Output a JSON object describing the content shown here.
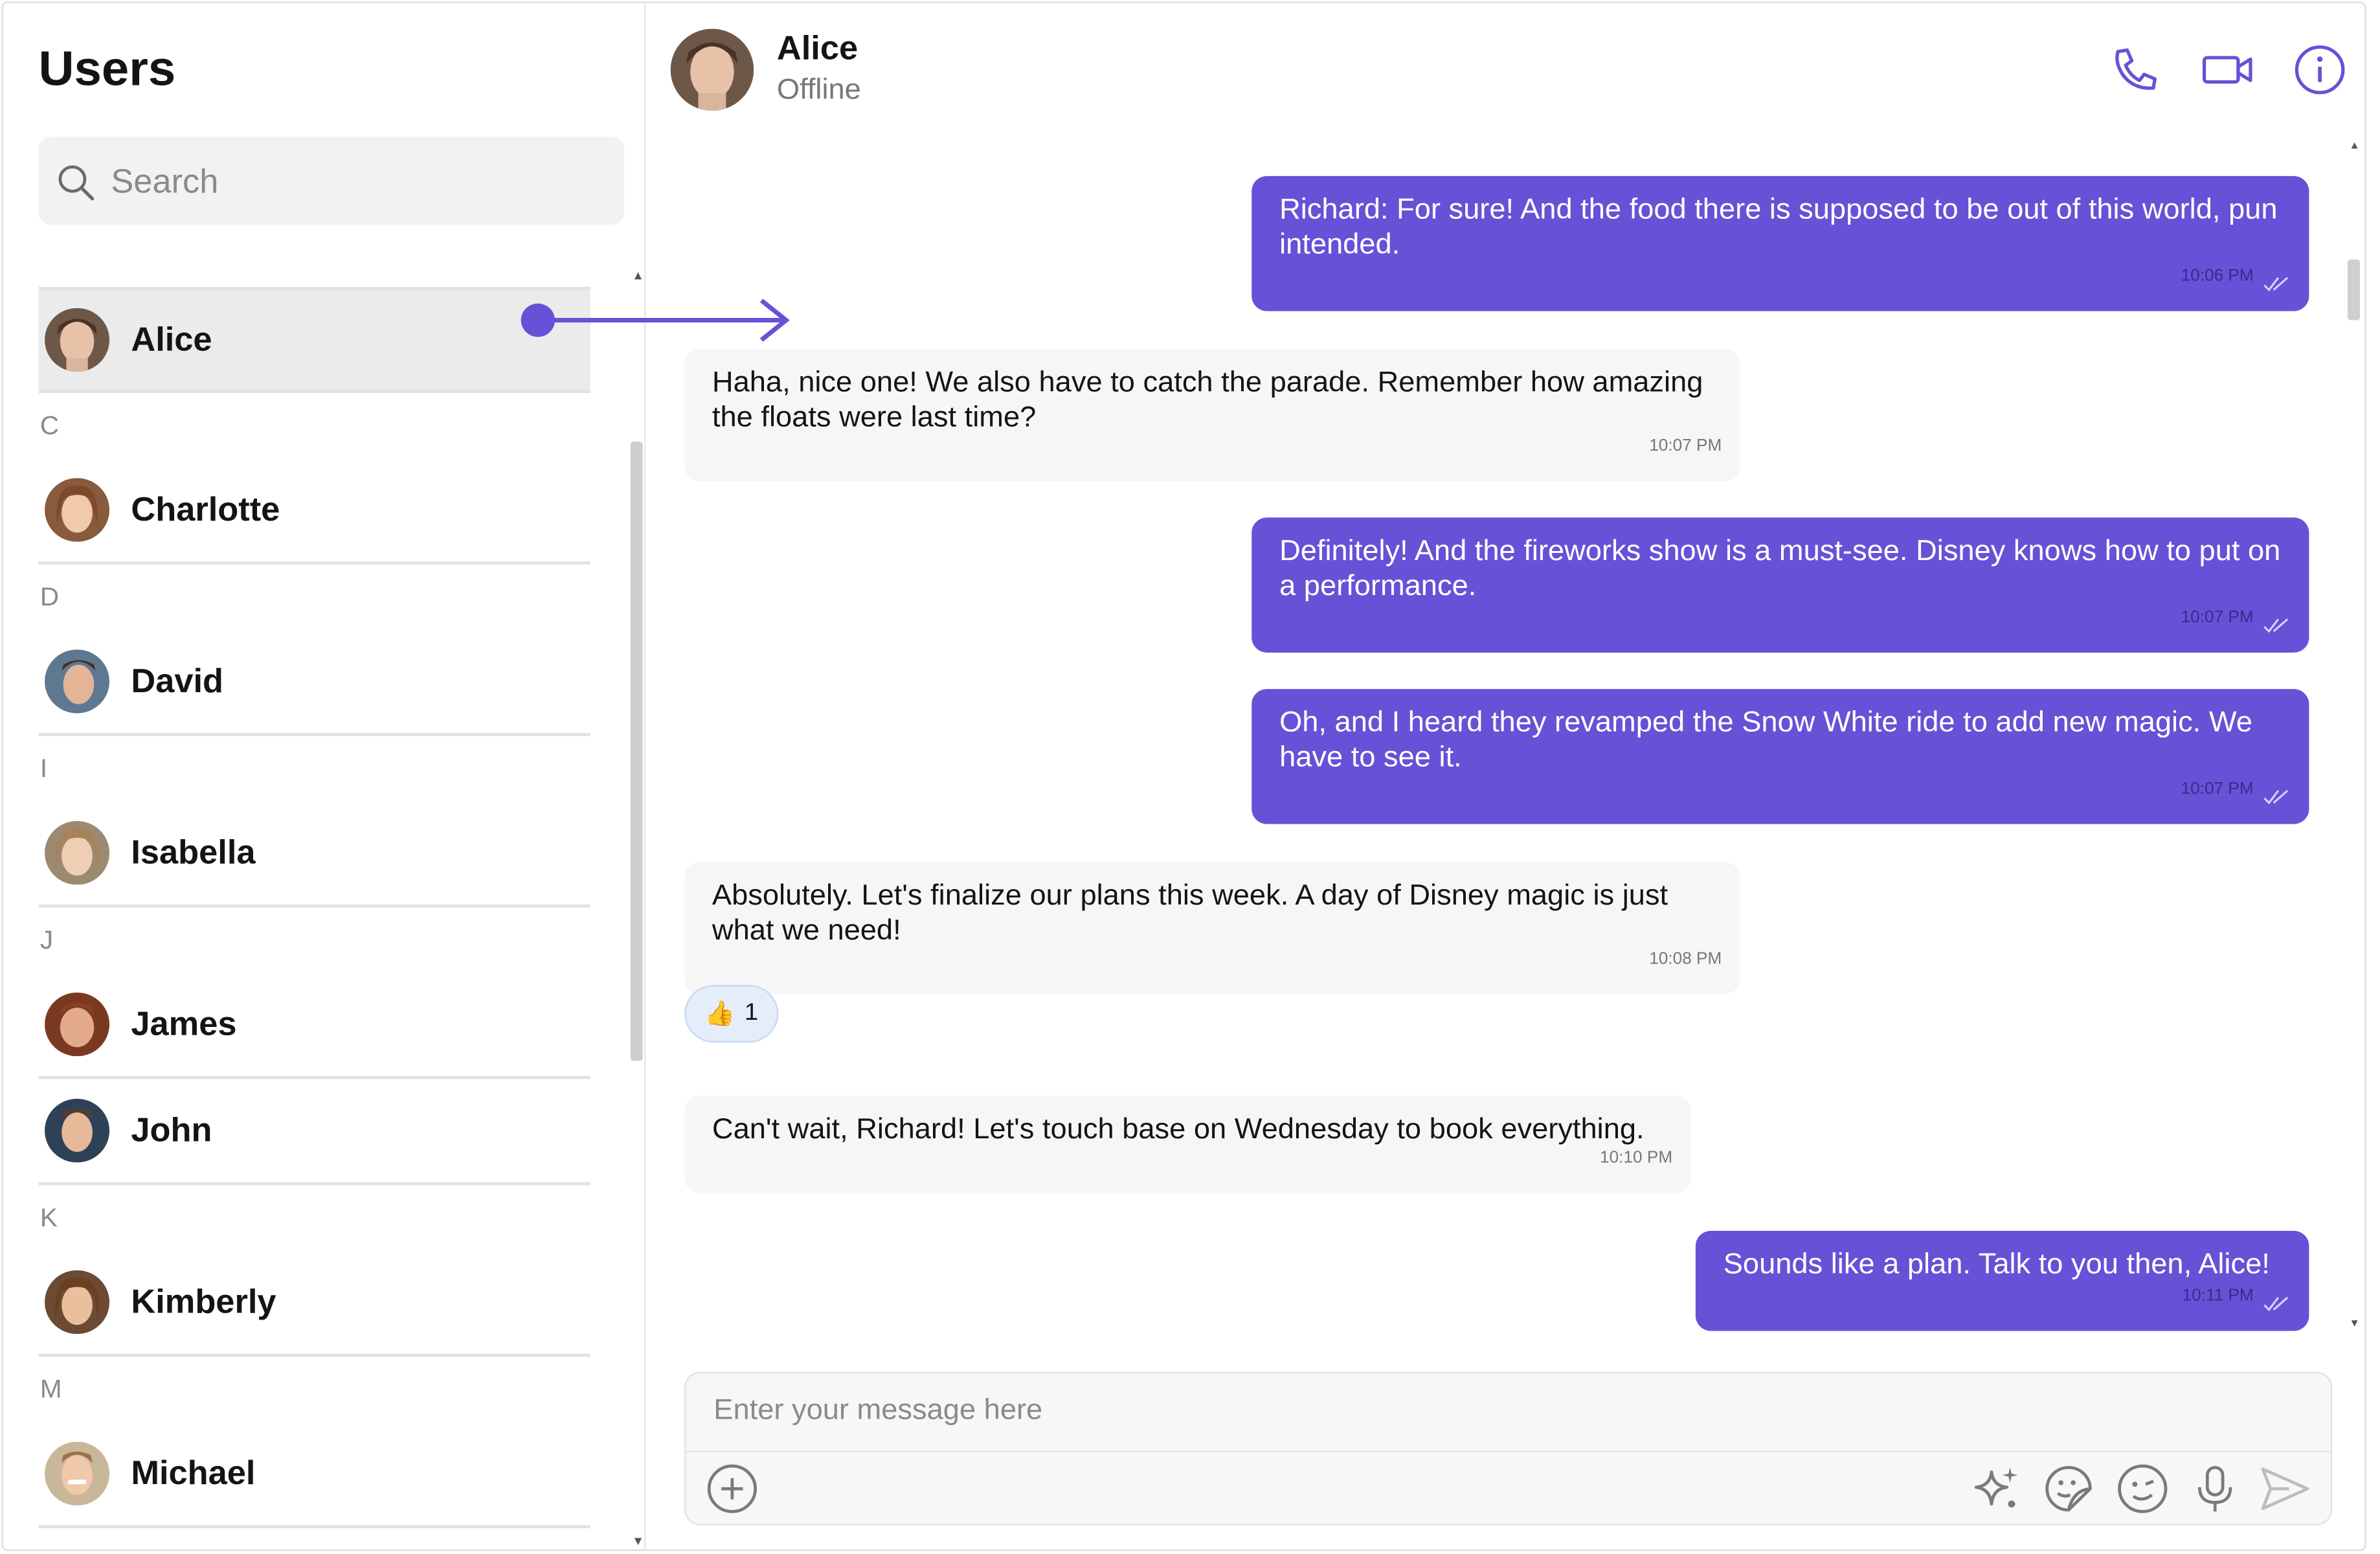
{
  "sidebar": {
    "title": "Users",
    "search_placeholder": "Search",
    "search_icon": "search-icon",
    "sections": [
      {
        "letter": "",
        "users": [
          "Alice"
        ]
      },
      {
        "letter": "C",
        "users": [
          "Charlotte"
        ]
      },
      {
        "letter": "D",
        "users": [
          "David"
        ]
      },
      {
        "letter": "I",
        "users": [
          "Isabella"
        ]
      },
      {
        "letter": "J",
        "users": [
          "James",
          "John"
        ]
      },
      {
        "letter": "K",
        "users": [
          "Kimberly"
        ]
      },
      {
        "letter": "M",
        "users": [
          "Michael"
        ]
      }
    ],
    "selected_user": "Alice"
  },
  "chat": {
    "header": {
      "name": "Alice",
      "status": "Offline",
      "icons": [
        "phone-icon",
        "video-call-icon",
        "info-icon"
      ]
    },
    "messages": [
      {
        "direction": "outgoing",
        "text": "Richard: For sure! And the food there is supposed to be out of this world, pun intended.",
        "time": "10:06 PM",
        "read": true
      },
      {
        "direction": "incoming",
        "text": "Haha, nice one! We also have to catch the parade. Remember how amazing the floats were last time?",
        "time": "10:07 PM"
      },
      {
        "direction": "outgoing",
        "text": "Definitely! And the fireworks show is a must-see. Disney knows how to put on a performance.",
        "time": "10:07 PM",
        "read": true
      },
      {
        "direction": "outgoing",
        "text": "Oh, and I heard they revamped the Snow White ride to add new magic. We have to see it.",
        "time": "10:07 PM",
        "read": true
      },
      {
        "direction": "incoming",
        "text": "Absolutely. Let's finalize our plans this week. A day of Disney magic is just what we need!",
        "time": "10:08 PM",
        "reaction": {
          "emoji": "👍",
          "count": "1"
        }
      },
      {
        "direction": "incoming",
        "text": "Can't wait, Richard! Let's touch base on Wednesday to book everything.",
        "time": "10:10 PM"
      },
      {
        "direction": "outgoing",
        "text": "Sounds like a plan. Talk to you then, Alice!",
        "time": "10:11 PM",
        "read": true
      }
    ],
    "composer": {
      "placeholder": "Enter your message here",
      "icons": [
        "add-attachment-icon",
        "ai-sparkle-icon",
        "sticker-icon",
        "emoji-icon",
        "microphone-icon",
        "send-icon"
      ]
    }
  },
  "colors": {
    "accent": "#6851d6",
    "incoming_bubble": "#f6f6f6",
    "selected_row": "#ebebeb"
  }
}
